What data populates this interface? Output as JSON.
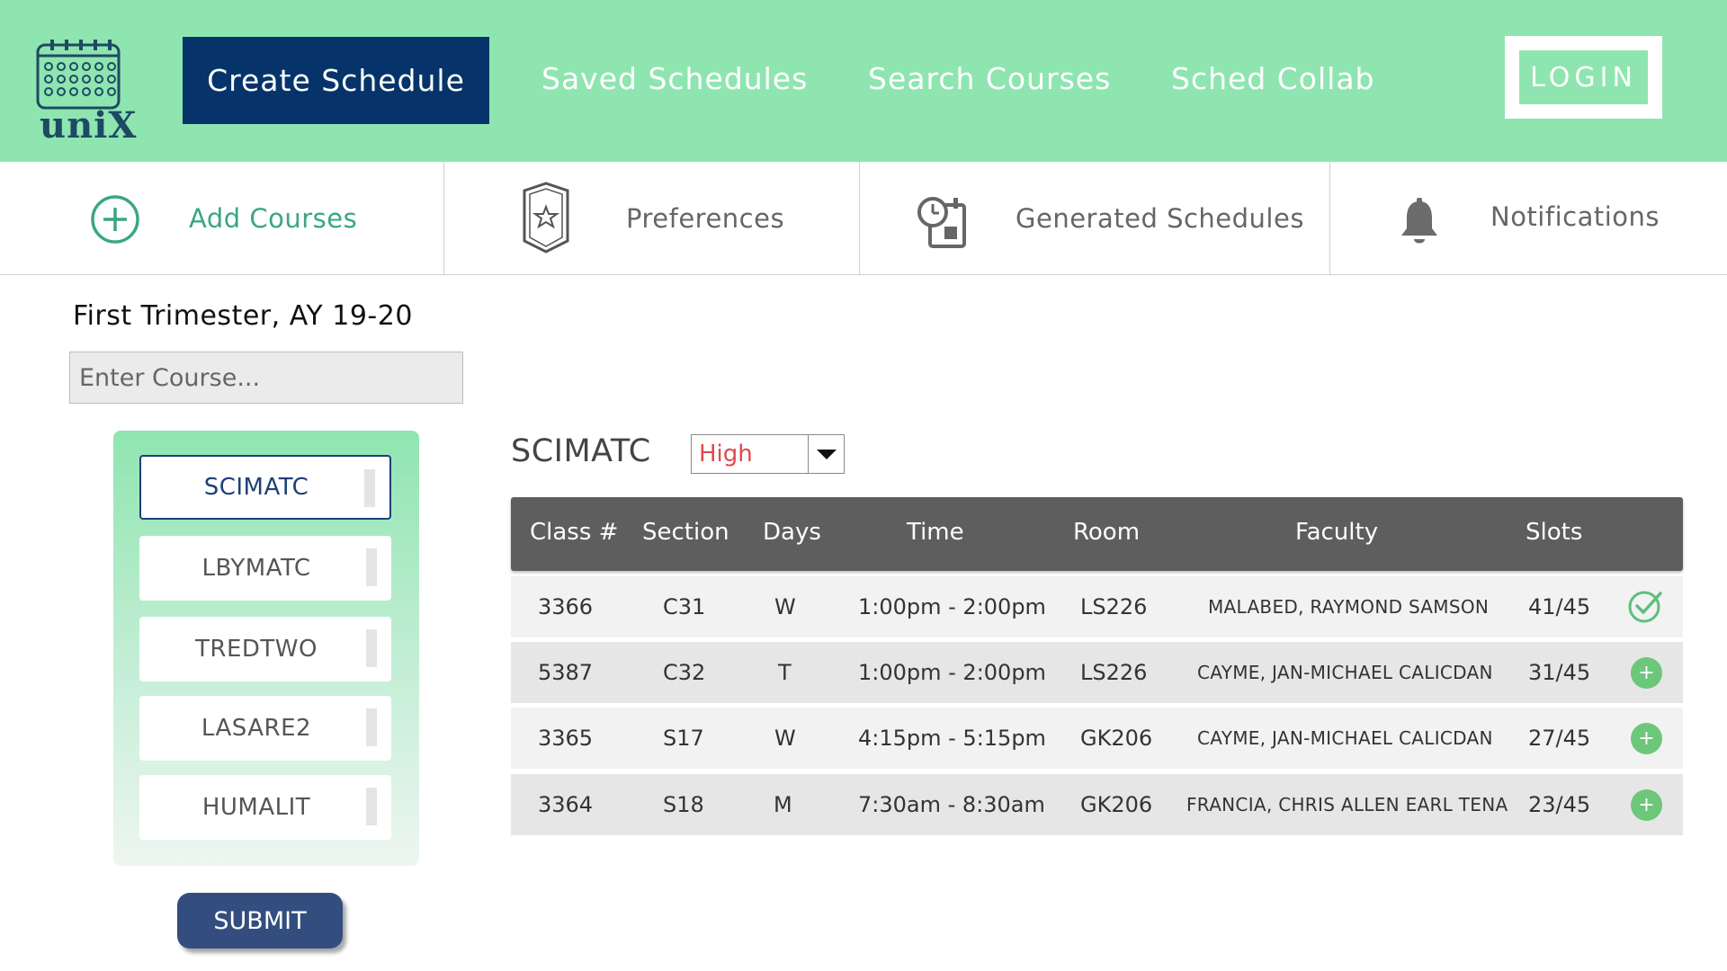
{
  "app": {
    "logo_text": "uniX"
  },
  "nav": {
    "active": "Create Schedule",
    "items": [
      "Saved Schedules",
      "Search Courses",
      "Sched Collab"
    ],
    "login": "LOGIN"
  },
  "tabs": [
    {
      "label": "Add Courses",
      "icon": "plus-circle-icon",
      "active": true
    },
    {
      "label": "Preferences",
      "icon": "badge-star-icon",
      "active": false
    },
    {
      "label": "Generated Schedules",
      "icon": "clock-calendar-icon",
      "active": false
    },
    {
      "label": "Notifications",
      "icon": "bell-icon",
      "active": false
    }
  ],
  "left": {
    "term": "First Trimester, AY 19-20",
    "input_placeholder": "Enter Course...",
    "courses": [
      "SCIMATC",
      "LBYMATC",
      "TREDTWO",
      "LASARE2",
      "HUMALIT"
    ],
    "submit": "SUBMIT"
  },
  "main": {
    "course": "SCIMATC",
    "priority": "High",
    "columns": [
      "Class #",
      "Section",
      "Days",
      "Time",
      "Room",
      "Faculty",
      "Slots"
    ],
    "rows": [
      {
        "class_no": "3366",
        "section": "C31",
        "days": "W",
        "time": "1:00pm - 2:00pm",
        "room": "LS226",
        "faculty": "MALABED, RAYMOND SAMSON",
        "slots": "41/45",
        "action": "check-icon"
      },
      {
        "class_no": "5387",
        "section": "C32",
        "days": "T",
        "time": "1:00pm - 2:00pm",
        "room": "LS226",
        "faculty": "CAYME, JAN-MICHAEL CALICDAN",
        "slots": "31/45",
        "action": "plus-icon"
      },
      {
        "class_no": "3365",
        "section": "S17",
        "days": "W",
        "time": "4:15pm - 5:15pm",
        "room": "GK206",
        "faculty": "CAYME, JAN-MICHAEL CALICDAN",
        "slots": "27/45",
        "action": "plus-icon"
      },
      {
        "class_no": "3364",
        "section": "S18",
        "days": "M",
        "time": "7:30am - 8:30am",
        "room": "GK206",
        "faculty": "FRANCIA, CHRIS ALLEN EARL TENA",
        "slots": "23/45",
        "action": "plus-icon"
      }
    ],
    "add_symbol": "+"
  },
  "colors": {
    "accent_green": "#8fe5b0",
    "navy": "#06346a",
    "submit_blue": "#334e7e",
    "priority_red": "#e04a4a",
    "table_header": "#5e5e5e",
    "add_green": "#6cc77a"
  }
}
